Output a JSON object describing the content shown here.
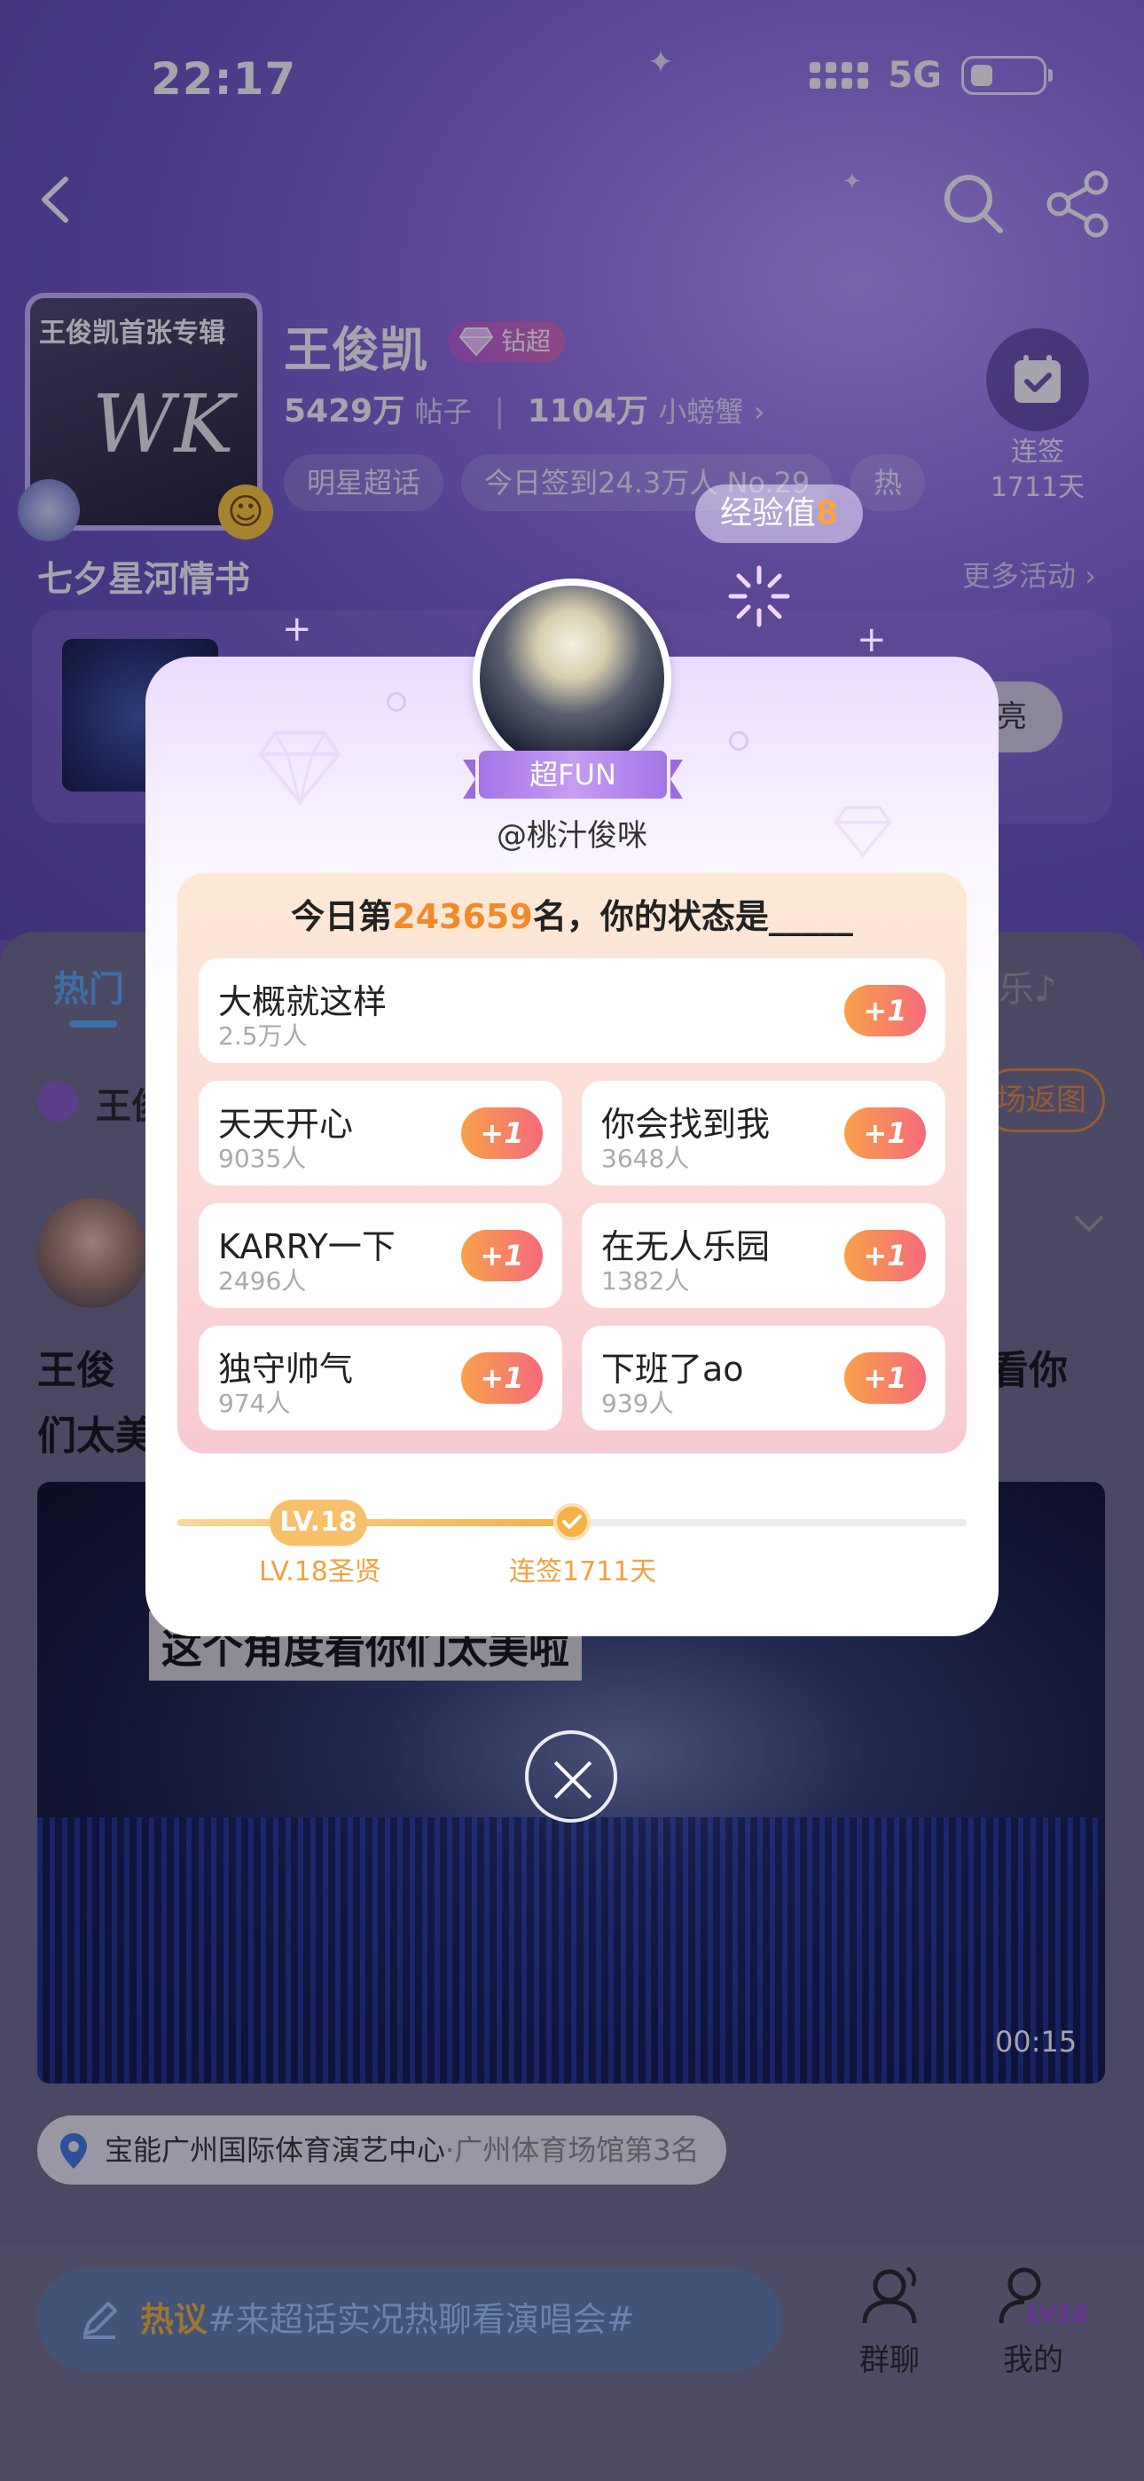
{
  "status_bar": {
    "time": "22:17",
    "network": "5G"
  },
  "header": {
    "star_name": "王俊凯",
    "badge": "钻超",
    "posts_count": "5429万",
    "posts_label": "帖子",
    "fans_count": "1104万",
    "fans_label": "小螃蟹",
    "tags": [
      "明星超话",
      "今日签到24.3万人 No.29",
      "热"
    ],
    "checkin_label": "连签",
    "checkin_days": "1711天",
    "album_title": "王俊凯首张专辑",
    "album_mark": "WK"
  },
  "exp_toast": {
    "label": "经验值",
    "value": "8"
  },
  "event": {
    "title": "七夕星河情书",
    "more": "更多活动 ›",
    "button": "亮"
  },
  "feed": {
    "tab_hot": "热门",
    "tab_music": "乐♪",
    "topic_prefix": "王俊",
    "return_label": "场返图",
    "post_line1_start": "王俊",
    "post_line1_end": "看你",
    "post_line2": "们太美",
    "video_caption": "这个角度看你们太美啦",
    "video_duration": "00:15",
    "location_main": "宝能广州国际体育演艺中心",
    "location_sub": "·广州体育场馆第3名"
  },
  "bottom_bar": {
    "input_hot": "热议",
    "input_topic": "#来超话实况热聊看演唱会#",
    "group_chat": "群聊",
    "mine": "我的",
    "mine_level": "LV18"
  },
  "modal": {
    "badge": "超FUN",
    "handle": "@桃汁俊咪",
    "question_prefix": "今日第",
    "rank": "243659",
    "question_suffix": "名，你的状态是_____",
    "plus_label": "+1",
    "options": [
      {
        "name": "大概就这样",
        "count": "2.5万人"
      },
      {
        "name": "天天开心",
        "count": "9035人"
      },
      {
        "name": "你会找到我",
        "count": "3648人"
      },
      {
        "name": "KARRY一下",
        "count": "2496人"
      },
      {
        "name": "在无人乐园",
        "count": "1382人"
      },
      {
        "name": "独守帅气",
        "count": "974人"
      },
      {
        "name": "下班了ao",
        "count": "939人"
      }
    ],
    "level_pill": "LV.18",
    "level_title": "LV.18圣贤",
    "streak_label": "连签1711天",
    "progress_fraction": 0.5
  },
  "colors": {
    "accent_orange": "#f28a2a",
    "tab_blue": "#5aaaf0",
    "badge_purple": "#a474e8"
  }
}
